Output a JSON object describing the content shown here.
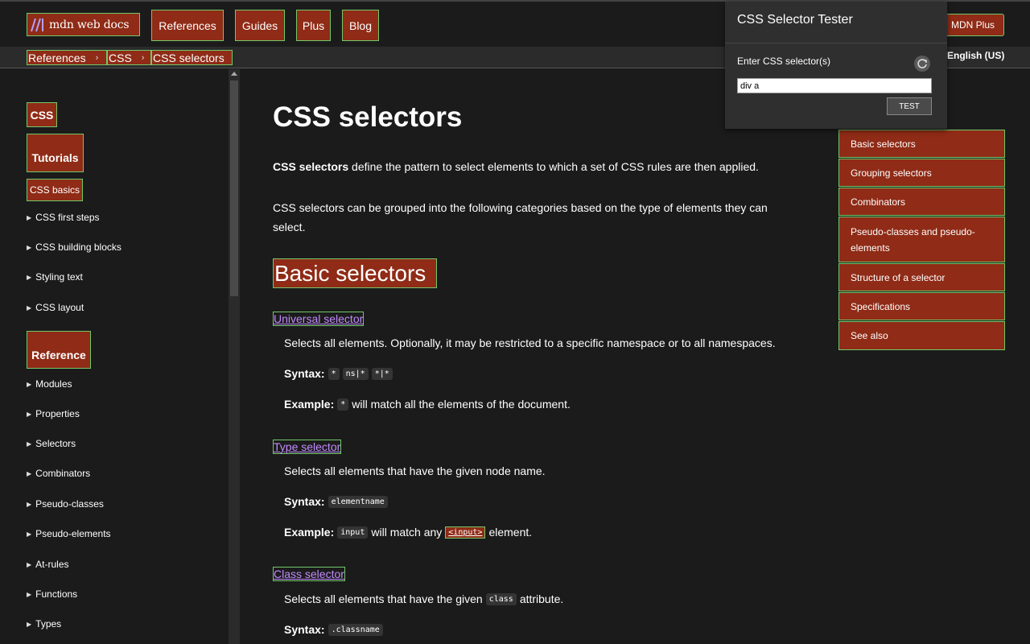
{
  "header": {
    "logo_text": "mdn web docs",
    "nav": [
      "References",
      "Guides",
      "Plus",
      "Blog"
    ],
    "plus_button": "MDN Plus"
  },
  "breadcrumb": {
    "items": [
      "References",
      "CSS",
      "CSS selectors"
    ],
    "separator": "›"
  },
  "language": "English (US)",
  "sidebar": {
    "css_head": "CSS",
    "tutorials_head": "Tutorials",
    "css_basics": "CSS basics",
    "tutorial_items": [
      "CSS first steps",
      "CSS building blocks",
      "Styling text",
      "CSS layout"
    ],
    "reference_head": "Reference",
    "reference_items": [
      "Modules",
      "Properties",
      "Selectors",
      "Combinators",
      "Pseudo-classes",
      "Pseudo-elements",
      "At-rules",
      "Functions",
      "Types"
    ]
  },
  "main": {
    "title": "CSS selectors",
    "intro_bold": "CSS selectors",
    "intro_rest": " define the pattern to select elements to which a set of CSS rules are then applied.",
    "para2_line1": "CSS selectors can be grouped into the following categories based on the type of elements they can",
    "para2_line2": "select.",
    "h2": "Basic selectors",
    "universal": {
      "term": "Universal selector",
      "desc": "Selects all elements. Optionally, it may be restricted to a specific namespace or to all namespaces.",
      "syntax_label": "Syntax:",
      "syntax_codes": [
        "*",
        "ns|*",
        "*|*"
      ],
      "example_label": "Example:",
      "example_code": "*",
      "example_rest": "will match all the elements of the document."
    },
    "type": {
      "term": "Type selector",
      "desc": "Selects all elements that have the given node name.",
      "syntax_label": "Syntax:",
      "syntax_code": "elementname",
      "example_label": "Example:",
      "example_code": "input",
      "example_mid": "will match any",
      "example_link": "<input>",
      "example_end": "element."
    },
    "class": {
      "term": "Class selector",
      "desc_pre": "Selects all elements that have the given",
      "desc_code": "class",
      "desc_post": "attribute.",
      "syntax_label": "Syntax:",
      "syntax_code": ".classname"
    }
  },
  "toc": [
    "Basic selectors",
    "Grouping selectors",
    "Combinators",
    "Pseudo-classes and pseudo-elements",
    "Structure of a selector",
    "Specifications",
    "See also"
  ],
  "popup": {
    "title": "CSS Selector Tester",
    "label": "Enter CSS selector(s)",
    "input_value": "div a",
    "button": "TEST",
    "refresh_icon": "refresh-icon"
  },
  "colors": {
    "highlight": "#8f2b16",
    "outline": "#72c86a",
    "link": "#c28bfe"
  }
}
